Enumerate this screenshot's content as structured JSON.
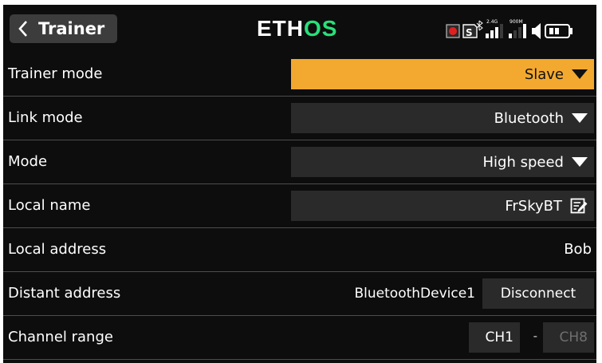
{
  "header": {
    "back_title": "Trainer",
    "logo_part1": "ETH",
    "logo_part2": "OS",
    "logo_colors": {
      "white": "#ffffff",
      "green": "#28e07a"
    },
    "status_icons": [
      "record-indicator-icon",
      "sd-card-icon",
      "bluetooth-icon",
      "signal-2-4g-icon",
      "signal-900m-icon",
      "speaker-icon",
      "battery-icon"
    ],
    "signal_labels": {
      "band1": "2.4G",
      "band2": "900M"
    },
    "sd_letter": "S"
  },
  "rows": {
    "trainer_mode": {
      "label": "Trainer mode",
      "value": "Slave"
    },
    "link_mode": {
      "label": "Link mode",
      "value": "Bluetooth"
    },
    "mode": {
      "label": "Mode",
      "value": "High speed"
    },
    "local_name": {
      "label": "Local name",
      "value": "FrSkyBT"
    },
    "local_address": {
      "label": "Local address",
      "value": "Bob"
    },
    "distant_address": {
      "label": "Distant address",
      "device": "BluetoothDevice1",
      "button": "Disconnect"
    },
    "channel_range": {
      "label": "Channel range",
      "from": "CH1",
      "separator": "-",
      "to": "CH8"
    }
  },
  "colors": {
    "accent_orange": "#f3a92f",
    "background": "#0d0d0d",
    "field": "#2a2a2a",
    "record_red": "#e02020"
  }
}
